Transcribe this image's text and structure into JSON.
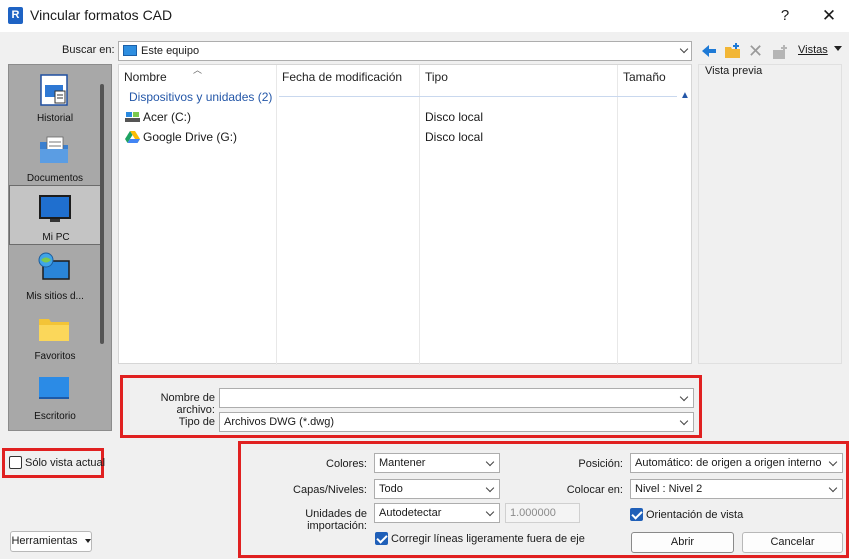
{
  "window": {
    "title": "Vincular formatos CAD",
    "app_icon": "R",
    "help_label": "?",
    "close_label": "✕"
  },
  "toolbar": {
    "lookin_label": "Buscar en:",
    "lookin_value": "Este equipo",
    "views_label": "Vistas",
    "icons": [
      "back-arrow-icon",
      "new-folder-icon",
      "delete-icon",
      "properties-icon"
    ]
  },
  "sidebar": {
    "items": [
      {
        "label": "Historial",
        "icon": "history-icon"
      },
      {
        "label": "Documentos",
        "icon": "documents-icon"
      },
      {
        "label": "Mi PC",
        "icon": "computer-icon"
      },
      {
        "label": "Mis sitios d...",
        "icon": "network-sites-icon"
      },
      {
        "label": "Favoritos",
        "icon": "favorites-folder-icon"
      },
      {
        "label": "Escritorio",
        "icon": "desktop-icon"
      }
    ]
  },
  "filelist": {
    "columns": [
      "Nombre",
      "Fecha de modificación",
      "Tipo",
      "Tamaño"
    ],
    "group_header": "Dispositivos y unidades (2)",
    "rows": [
      {
        "name": "Acer (C:)",
        "type": "Disco local",
        "icon": "drive-icon"
      },
      {
        "name": "Google Drive (G:)",
        "type": "Disco local",
        "icon": "google-drive-icon"
      }
    ]
  },
  "preview": {
    "label": "Vista previa"
  },
  "file": {
    "name_label": "Nombre de archivo:",
    "name_value": "",
    "type_label": "Tipo de",
    "type_value": "Archivos DWG (*.dwg)"
  },
  "options": {
    "current_view_only_label": "Sólo vista actual",
    "current_view_only_checked": false,
    "colors_label": "Colores:",
    "colors_value": "Mantener",
    "layers_label": "Capas/Niveles:",
    "layers_value": "Todo",
    "units_label": "Unidades de importación:",
    "units_value": "Autodetectar",
    "scale_value": "1.000000",
    "correct_lines_label": "Corregir líneas ligeramente fuera de eje",
    "correct_lines_checked": true,
    "position_label": "Posición:",
    "position_value": "Automático: de origen a origen interno",
    "place_at_label": "Colocar en:",
    "place_at_value": "Nivel : Nivel 2",
    "orient_label": "Orientación de vista",
    "orient_checked": true
  },
  "buttons": {
    "tools": "Herramientas",
    "open": "Abrir",
    "cancel": "Cancelar"
  },
  "colors": {
    "highlight": "#e02020",
    "accent": "#1f5fb8",
    "link": "#2457a8"
  }
}
